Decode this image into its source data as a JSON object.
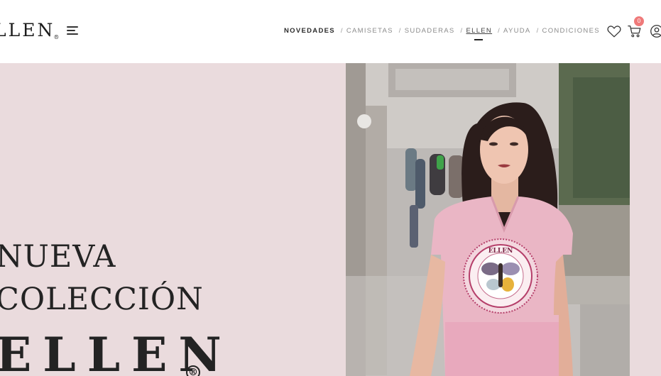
{
  "header": {
    "logo_text": "LLEN",
    "logo_reg": "®",
    "nav": [
      {
        "label": "NOVEDADES"
      },
      {
        "label": "CAMISETAS"
      },
      {
        "label": "SUDADERAS"
      },
      {
        "label": "ELLEN"
      },
      {
        "label": "AYUDA"
      },
      {
        "label": "CONDICIONES"
      }
    ],
    "separator": "/",
    "cart_count": "0",
    "icons": [
      "menu-icon",
      "heart-icon",
      "cart-icon",
      "user-icon"
    ]
  },
  "hero": {
    "line1": "NUEVA",
    "line2": "COLECCIÓN",
    "line3": "ELLEN",
    "reg_mark": "®",
    "shirt_text": "ELLEN",
    "background_color": "#eadbdd",
    "accent_color": "#ef7a7a"
  }
}
